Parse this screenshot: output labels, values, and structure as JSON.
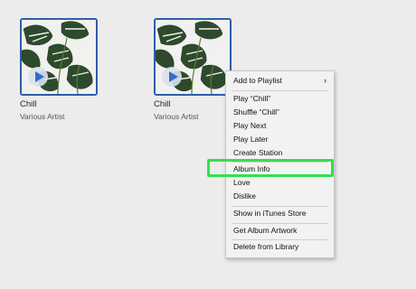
{
  "albums": [
    {
      "title": "Chill",
      "artist": "Various Artist"
    },
    {
      "title": "Chill",
      "artist": "Various Artist"
    }
  ],
  "context_menu": {
    "add_to_playlist": "Add to Playlist",
    "play": "Play “Chill”",
    "shuffle": "Shuffle “Chill”",
    "play_next": "Play Next",
    "play_later": "Play Later",
    "create_station": "Create Station",
    "album_info": "Album Info",
    "love": "Love",
    "dislike": "Dislike",
    "show_in_store": "Show in iTunes Store",
    "get_artwork": "Get Album Artwork",
    "delete": "Delete from Library",
    "submenu_arrow": "›"
  },
  "colors": {
    "selection_border": "#2f5ea8",
    "highlight": "#33e04a",
    "play_triangle": "#2f6fd0"
  }
}
